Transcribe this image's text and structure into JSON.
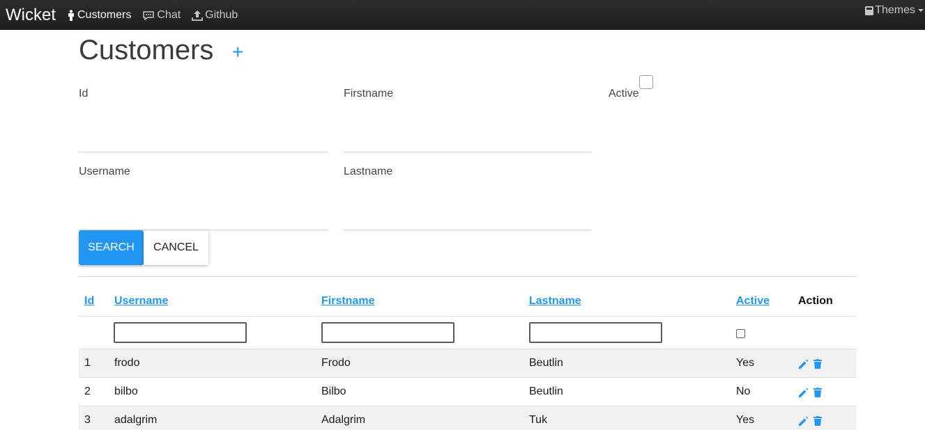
{
  "navbar": {
    "brand": "Wicket",
    "links": [
      {
        "label": "Customers",
        "icon": "person-icon"
      },
      {
        "label": "Chat",
        "icon": "chat-icon"
      },
      {
        "label": "Github",
        "icon": "upload-icon"
      }
    ],
    "themes_label": "Themes",
    "themes_icon": "book-icon"
  },
  "page": {
    "title": "Customers",
    "add_label": "+"
  },
  "form": {
    "id_label": "Id",
    "firstname_label": "Firstname",
    "active_label": "Active",
    "username_label": "Username",
    "lastname_label": "Lastname",
    "search_label": "SEARCH",
    "cancel_label": "CANCEL"
  },
  "table": {
    "headers": [
      "Id",
      "Username",
      "Firstname",
      "Lastname",
      "Active",
      "Action"
    ],
    "rows": [
      {
        "id": "1",
        "username": "frodo",
        "firstname": "Frodo",
        "lastname": "Beutlin",
        "active": "Yes"
      },
      {
        "id": "2",
        "username": "bilbo",
        "firstname": "Bilbo",
        "lastname": "Beutlin",
        "active": "No"
      },
      {
        "id": "3",
        "username": "adalgrim",
        "firstname": "Adalgrim",
        "lastname": "Tuk",
        "active": "Yes"
      }
    ]
  },
  "colors": {
    "accent": "#2196f3",
    "navbar": "#222222"
  }
}
